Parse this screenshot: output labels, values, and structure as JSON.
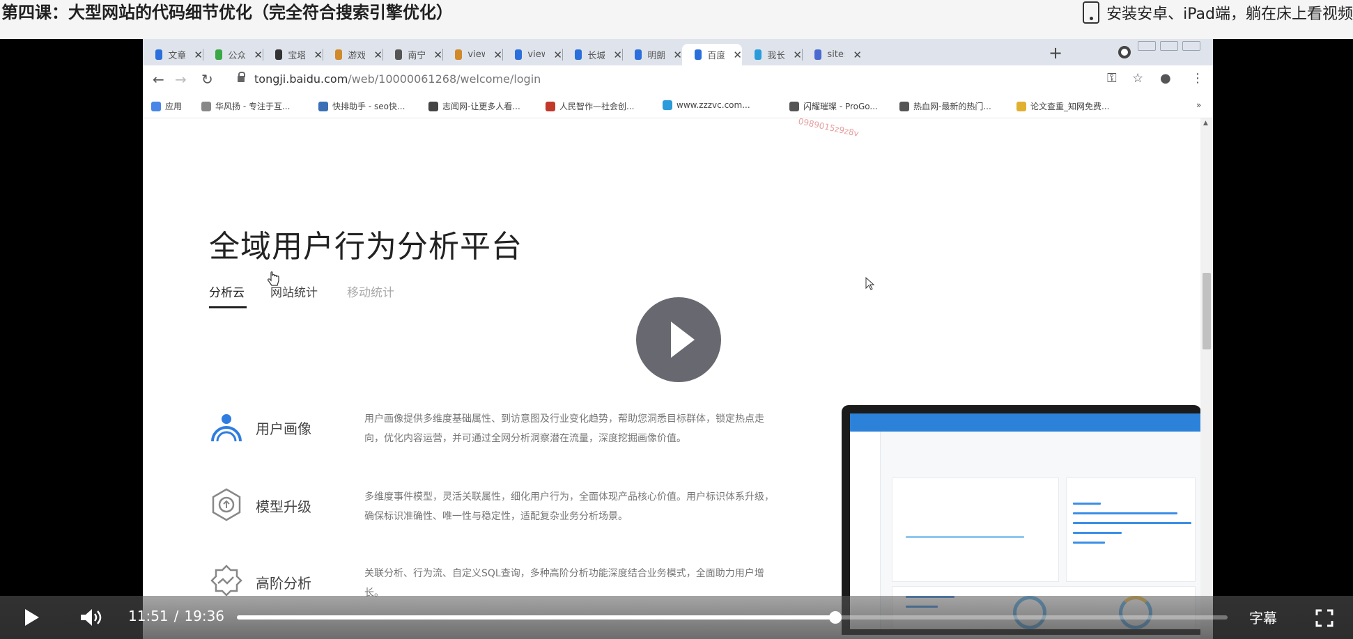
{
  "header": {
    "lesson_title": "第四课：大型网站的代码细节优化（完全符合搜索引擎优化）",
    "install_hint": "安装安卓、iPad端，躺在床上看视频"
  },
  "browser": {
    "tabs": [
      {
        "label": "文章",
        "color": "#2a6fdb"
      },
      {
        "label": "公众",
        "color": "#39a845"
      },
      {
        "label": "宝塔",
        "color": "#333333"
      },
      {
        "label": "游戏",
        "color": "#d08a2a"
      },
      {
        "label": "南宁",
        "color": "#555555"
      },
      {
        "label": "view",
        "color": "#d08a2a"
      },
      {
        "label": "view",
        "color": "#2a6fdb"
      },
      {
        "label": "长城",
        "color": "#2a6fdb"
      },
      {
        "label": "明朗",
        "color": "#2a6fdb"
      },
      {
        "label": "百度",
        "color": "#2a6fdb",
        "active": true
      },
      {
        "label": "我长",
        "color": "#2a9bdb"
      },
      {
        "label": "sites",
        "color": "#4a6ad0"
      }
    ],
    "url_host": "tongji.baidu.com",
    "url_path": "/web/10000061268/welcome/login",
    "bookmarks": [
      "应用",
      "华风扬 - 专注于互...",
      "快排助手 - seo快...",
      "志闻网-让更多人看...",
      "人民智作—社会创...",
      "www.zzzvc.com...",
      "闪耀璀璨 - ProGo...",
      "热血网-最新的热门...",
      "论文查重_知网免费..."
    ]
  },
  "site": {
    "watermark": "0989015z9z8v",
    "title": "全域用户行为分析平台",
    "tabs": [
      {
        "label": "分析云",
        "active": true
      },
      {
        "label": "网站统计",
        "active": false
      },
      {
        "label": "移动统计",
        "active": false
      }
    ],
    "features": [
      {
        "name": "用户画像",
        "desc": "用户画像提供多维度基础属性、到访意图及行业变化趋势，帮助您洞悉目标群体，锁定热点走向，优化内容运营，并可通过全网分析洞察潜在流量，深度挖掘画像价值。"
      },
      {
        "name": "模型升级",
        "desc": "多维度事件模型，灵活关联属性，细化用户行为，全面体现产品核心价值。用户标识体系升级，确保标识准确性、唯一性与稳定性，适配复杂业务分析场景。"
      },
      {
        "name": "高阶分析",
        "desc": "关联分析、行为流、自定义SQL查询，多种高阶分析功能深度结合业务模式，全面助力用户增长。"
      }
    ]
  },
  "player": {
    "current_time": "11:51",
    "separator": "/",
    "duration": "19:36",
    "progress_fraction": 0.604,
    "subtitle_label": "字幕"
  }
}
